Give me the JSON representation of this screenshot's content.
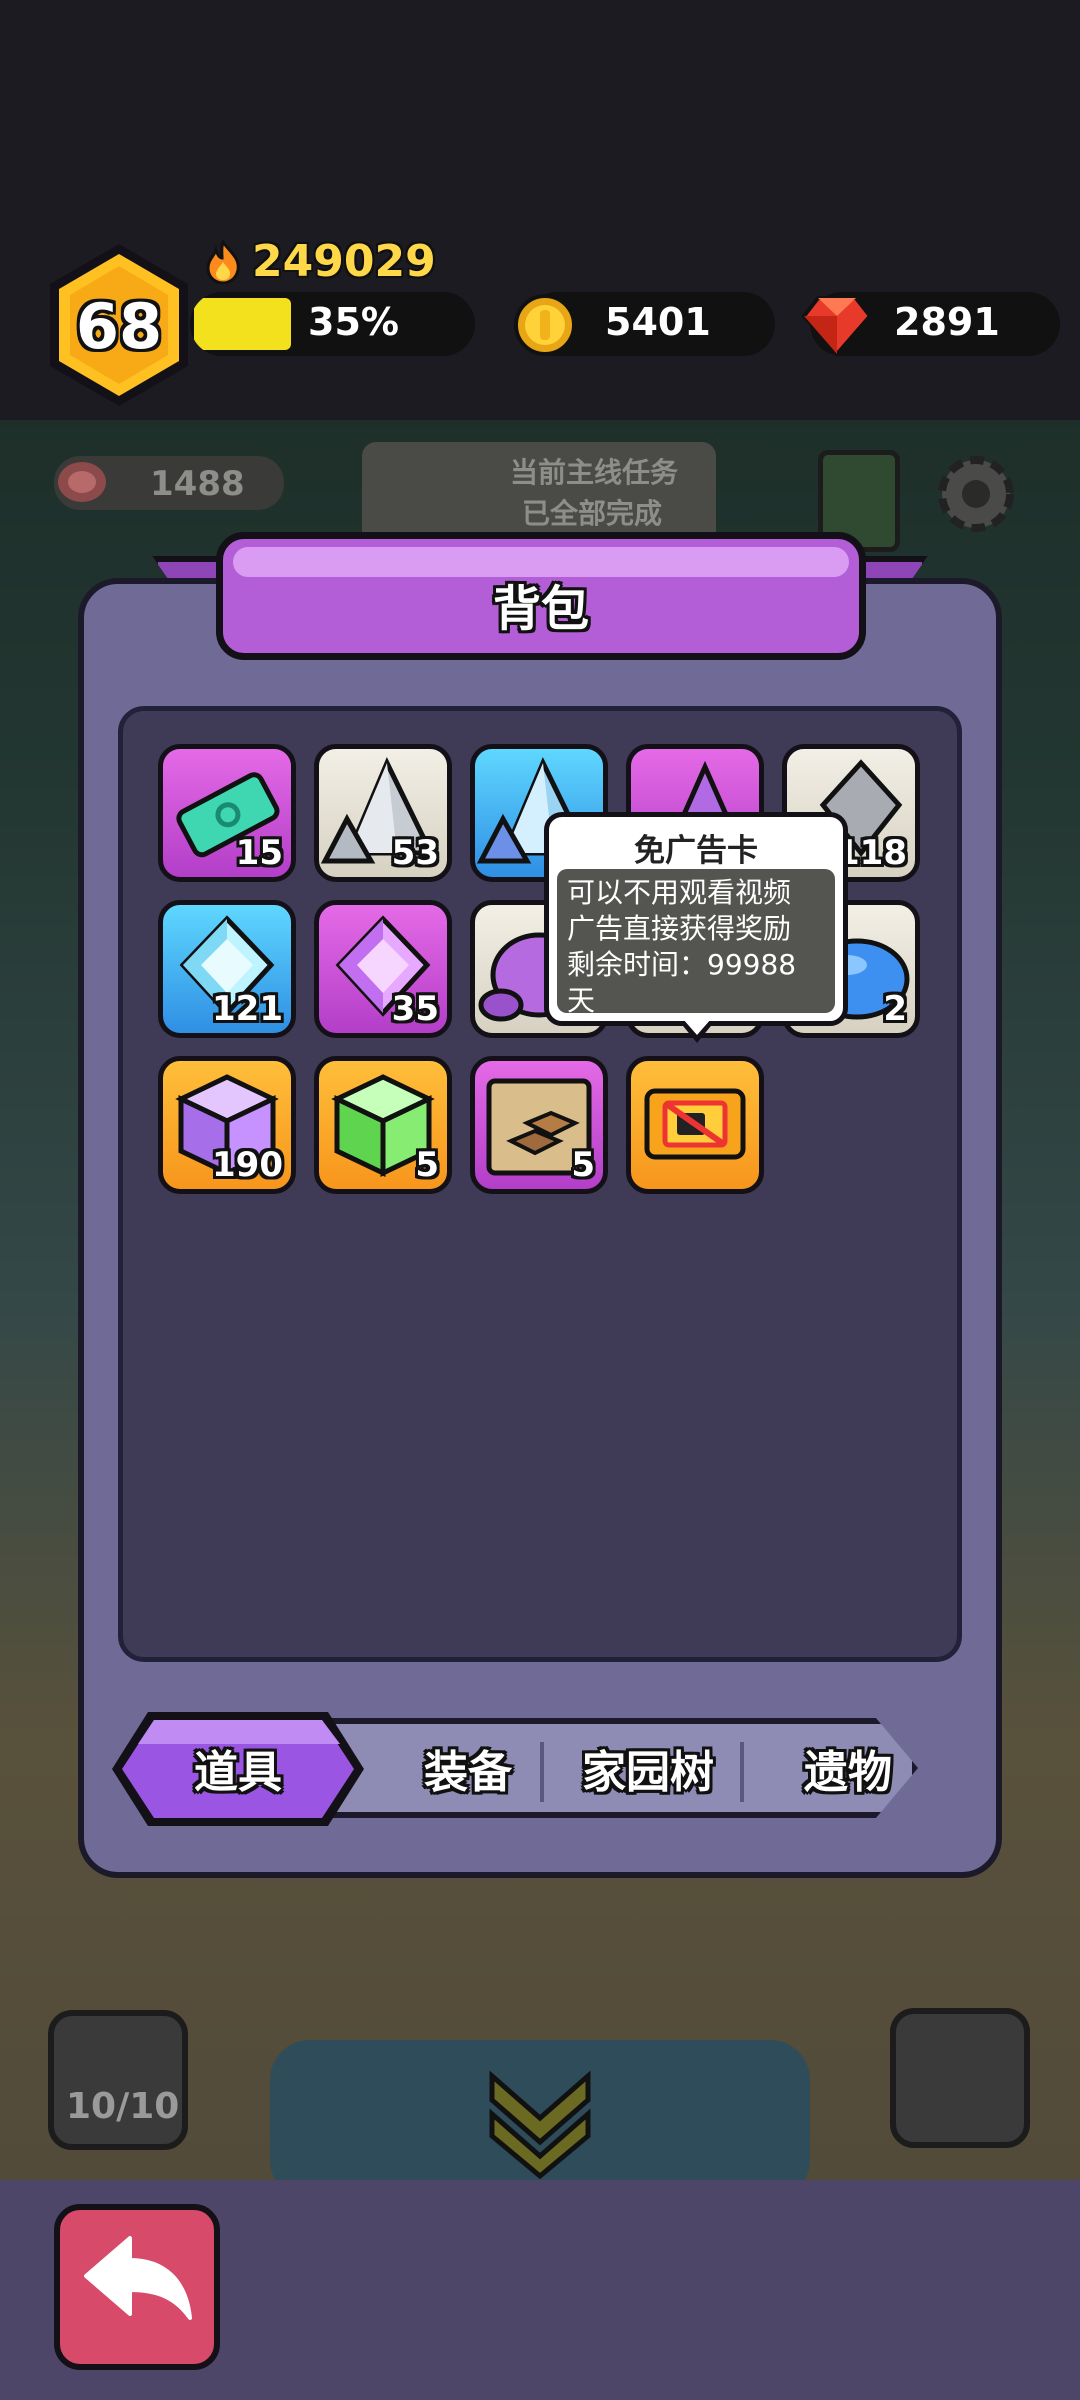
{
  "hud": {
    "level": "68",
    "power": "249029",
    "xp_percent": 35,
    "xp_label": "35%",
    "coins": "5401",
    "gems": "2891"
  },
  "scene": {
    "meat": "1488",
    "quest_text_1": "当前主线任务",
    "quest_text_2": "已全部完成",
    "slime_count": "10/10"
  },
  "panel": {
    "title": "背包"
  },
  "items": [
    {
      "icon": "ticket-icon",
      "count": "15"
    },
    {
      "icon": "grey-crystal-icon",
      "count": "53"
    },
    {
      "icon": "blue-crystal-icon",
      "count": ""
    },
    {
      "icon": "purple-crystal-icon",
      "count": ""
    },
    {
      "icon": "grey-gem-icon",
      "count": "118"
    },
    {
      "icon": "blue-diamond-icon",
      "count": "121"
    },
    {
      "icon": "purple-diamond-icon",
      "count": "35"
    },
    {
      "icon": "purple-ore-icon",
      "count": ""
    },
    {
      "icon": "hidden-item-icon",
      "count": ""
    },
    {
      "icon": "blue-slime-ore-icon",
      "count": "2"
    },
    {
      "icon": "purple-cube-icon",
      "count": "190"
    },
    {
      "icon": "green-cube-icon",
      "count": "5"
    },
    {
      "icon": "gold-bars-map-icon",
      "count": "5"
    },
    {
      "icon": "no-ad-card-icon",
      "count": ""
    }
  ],
  "tooltip": {
    "title": "免广告卡",
    "line1": "可以不用观看视频",
    "line2": "广告直接获得奖励",
    "line3": "剩余时间：99988",
    "line4": "天"
  },
  "tabs": [
    {
      "label": "道具",
      "active": true
    },
    {
      "label": "装备",
      "active": false
    },
    {
      "label": "家园树",
      "active": false
    },
    {
      "label": "遗物",
      "active": false
    }
  ],
  "colors": {
    "panel": "#6f6b96",
    "grid": "#3f3b57",
    "title": "#b35ed6",
    "back_button": "#d84a69"
  }
}
